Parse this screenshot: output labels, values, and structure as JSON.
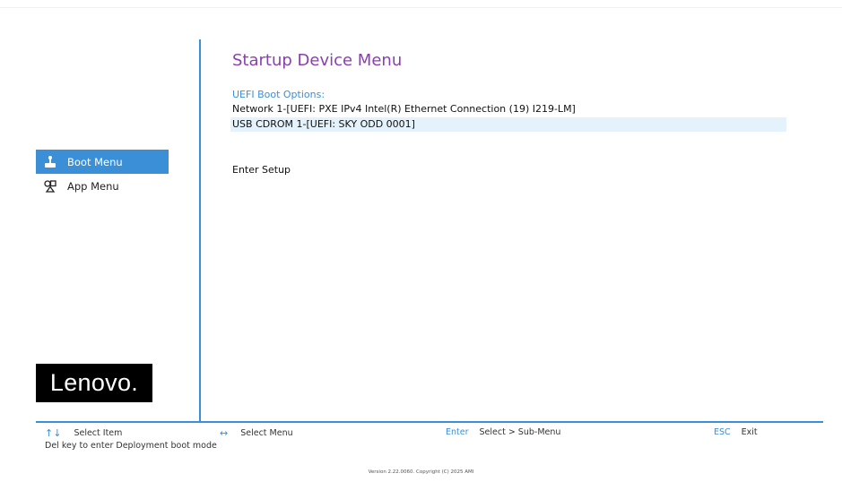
{
  "sidebar": {
    "items": [
      {
        "label": "Boot Menu",
        "icon": "boot-menu-icon",
        "active": true
      },
      {
        "label": "App Menu",
        "icon": "app-menu-icon",
        "active": false
      }
    ],
    "logo_text": "Lenovo."
  },
  "main": {
    "title": "Startup Device Menu",
    "section_label": "UEFI Boot Options:",
    "boot_options": [
      "Network 1-[UEFI: PXE IPv4 Intel(R) Ethernet Connection (19) I219-LM]",
      "USB CDROM 1-[UEFI: SKY ODD 0001]"
    ],
    "selected_option_index": 1,
    "enter_setup": "Enter Setup"
  },
  "footer": {
    "hints": [
      {
        "key": "↑↓",
        "label": "Select Item"
      },
      {
        "key": "↔",
        "label": "Select Menu"
      },
      {
        "key": "Enter",
        "label": "Select > Sub-Menu"
      },
      {
        "key": "ESC",
        "label": "Exit"
      }
    ],
    "deployment_hint": "Del key to enter Deployment boot mode",
    "version": "Version 2.22.0060. Copyright (C) 2025 AMI"
  },
  "colors": {
    "accent": "#3b8fd6",
    "title": "#8a3fb0",
    "highlight": "#e3f2fb",
    "logo_bg": "#000000"
  }
}
